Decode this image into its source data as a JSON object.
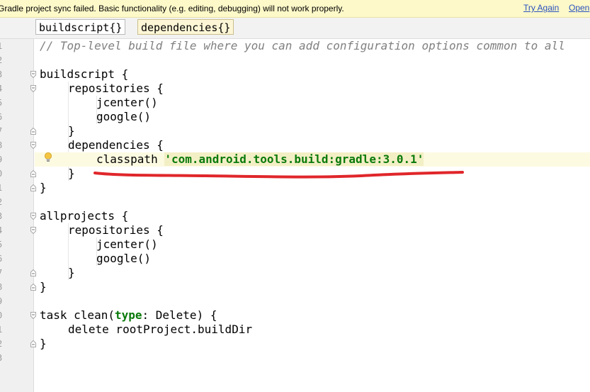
{
  "banner": {
    "message": "Gradle project sync failed. Basic functionality (e.g. editing, debugging) will not work properly.",
    "try_again": "Try Again",
    "open": "Open"
  },
  "breadcrumbs": [
    "buildscript{}",
    "dependencies{}"
  ],
  "line_numbers": [
    "1",
    "2",
    "3",
    "4",
    "5",
    "6",
    "7",
    "8",
    "9",
    "0",
    "1",
    "2",
    "3",
    "4",
    "5",
    "6",
    "7",
    "8",
    "9",
    "0",
    "1",
    "2",
    "3"
  ],
  "code": {
    "l1": "// Top-level build file where you can add configuration options common to all",
    "l3": "buildscript {",
    "l4": "repositories {",
    "l5": "jcenter()",
    "l6": "google()",
    "l7": "}",
    "l8": "dependencies {",
    "l9_prefix": "classpath ",
    "l9_string": "'com.android.tools.build:gradle:3.0.1'",
    "l10": "}",
    "l11": "}",
    "l13": "allprojects {",
    "l14": "repositories {",
    "l15": "jcenter()",
    "l16": "google()",
    "l17": "}",
    "l18": "}",
    "l20_a": "task clean(",
    "l20_kw": "type",
    "l20_b": ": Delete) {",
    "l21": "delete rootProject.buildDir",
    "l22": "}"
  },
  "colors": {
    "banner_bg": "#fdf9c9",
    "link": "#2a52be",
    "comment": "#808080",
    "string": "#0b7a0b",
    "annotation_underline": "#e0262a",
    "current_line_bg": "#fcfae1"
  }
}
